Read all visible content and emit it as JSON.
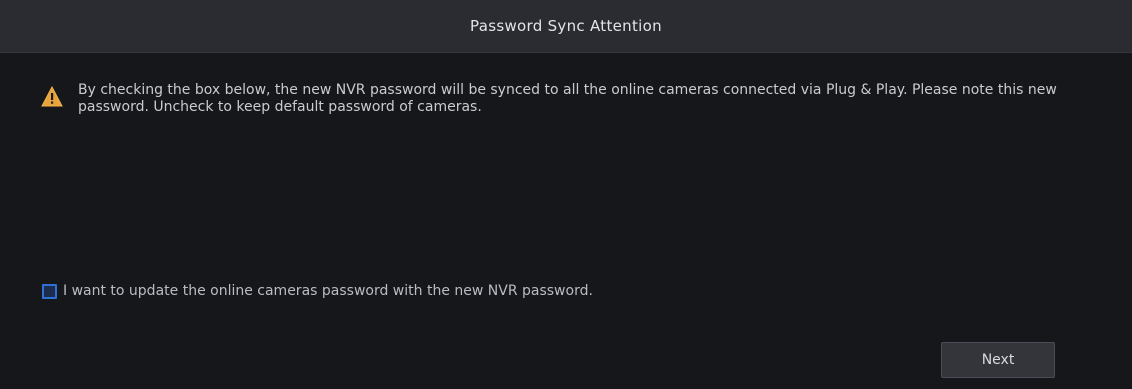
{
  "dialog": {
    "title": "Password Sync Attention",
    "warning_icon": "warning-triangle-icon",
    "message": "By checking the box below, the new NVR password will be synced to all the online cameras connected via Plug & Play. Please note this new password. Uncheck to keep default password of cameras.",
    "checkbox": {
      "label": "I want to update the online cameras password with the new NVR password.",
      "checked": false
    },
    "next_label": "Next"
  },
  "colors": {
    "background": "#16171b",
    "titlebar": "#2a2c31",
    "warning": "#e8a33b",
    "checkbox_border": "#2f6fd6"
  }
}
